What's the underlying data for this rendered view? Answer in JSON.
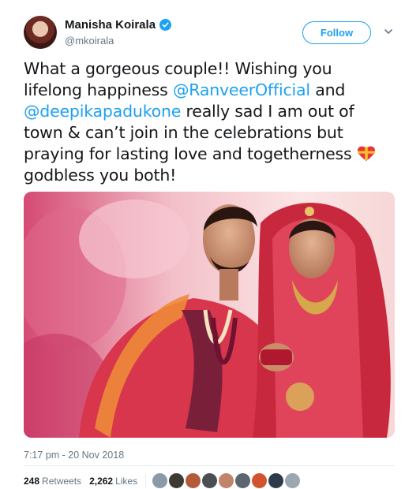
{
  "author": {
    "name": "Manisha Koirala",
    "handle": "@mkoirala",
    "verified": true
  },
  "follow_button": {
    "label": "Follow"
  },
  "tweet": {
    "line1": "What a gorgeous couple!! Wishing you",
    "line2_prefix": "lifelong happiness ",
    "mention1": "@RanveerOfficial",
    "line2_suffix": "  and",
    "mention2": "@deepikapadukone",
    "line3_suffix": " really sad I am out of",
    "line4": "town & can’t join in the celebrations but",
    "line5": "praying for lasting love and togetherness ",
    "line6": "godbless you both!"
  },
  "timestamp": "7:17 pm - 20 Nov 2018",
  "stats": {
    "retweets_count": "248",
    "retweets_label": "Retweets",
    "likes_count": "2,262",
    "likes_label": "Likes"
  },
  "colors": {
    "accent": "#1da1f2",
    "text": "#14171a",
    "muted": "#657786"
  },
  "icons": [
    "verified-badge-icon",
    "chevron-down-icon",
    "heart-gift-emoji"
  ]
}
